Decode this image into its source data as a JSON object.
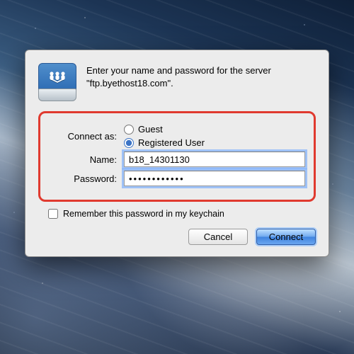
{
  "header": {
    "prompt": "Enter your name and password for the server \"ftp.byethost18.com\"."
  },
  "form": {
    "connect_as": {
      "label": "Connect as:",
      "options": [
        "Guest",
        "Registered User"
      ],
      "selected_index": 1
    },
    "name": {
      "label": "Name:",
      "value": "b18_14301130"
    },
    "password": {
      "label": "Password:",
      "value": "••••••••••••"
    },
    "remember_label": "Remember this password in my keychain",
    "remember_checked": false
  },
  "actions": {
    "cancel": "Cancel",
    "connect": "Connect"
  },
  "colors": {
    "highlight_border": "#e03a2f",
    "primary_button": "#5b95e6"
  }
}
